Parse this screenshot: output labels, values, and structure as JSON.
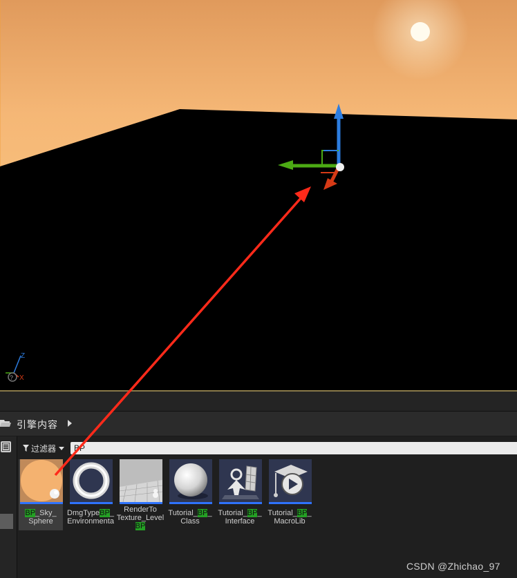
{
  "viewport": {
    "axis_labels": {
      "z": "Z",
      "x": "X"
    }
  },
  "content_browser": {
    "title": "引擎内容",
    "filter_label": "过滤器",
    "search_value": "BP",
    "assets": [
      {
        "pre": "",
        "hl": "BP",
        "post": "_Sky_",
        "line2": "Sphere",
        "icon": "sky-sphere-icon"
      },
      {
        "pre": "DmgType",
        "hl": "BP",
        "post": "_",
        "line2": "Environmenta",
        "icon": "ring-icon"
      },
      {
        "pre": "RenderTo",
        "hl": "",
        "post": "",
        "line2": "Texture_Level",
        "line3": "BP",
        "icon": "render-texture-icon"
      },
      {
        "pre": "Tutorial_",
        "hl": "BP",
        "post": "_",
        "line2": "Class",
        "icon": "sphere-icon"
      },
      {
        "pre": "Tutorial_",
        "hl": "BP",
        "post": "_",
        "line2": "Interface",
        "icon": "interface-icon"
      },
      {
        "pre": "Tutorial_",
        "hl": "BP",
        "post": "_",
        "line2": "MacroLib",
        "icon": "macro-icon"
      }
    ]
  },
  "watermark": "CSDN @Zhichao_97",
  "colors": {
    "accent": "#2f73ff",
    "highlight": "#24a024",
    "sky": "#f4b270"
  }
}
